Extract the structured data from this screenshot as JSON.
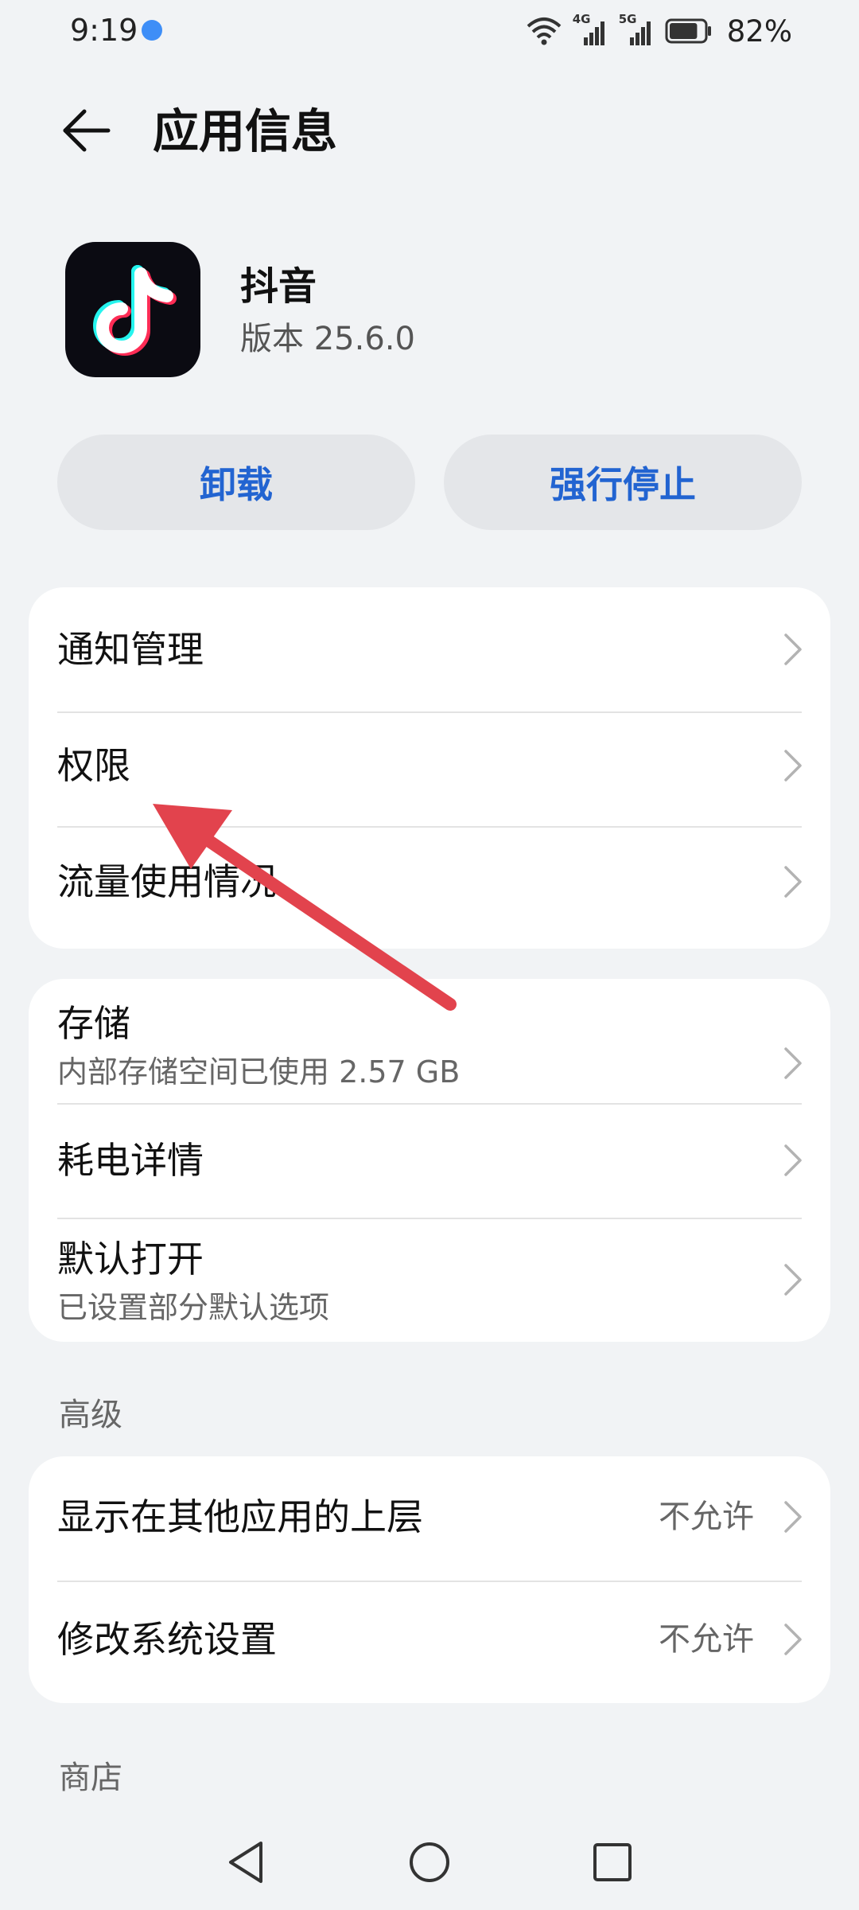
{
  "status_bar": {
    "time": "9:19",
    "network_1": "4G",
    "network_2": "5G",
    "battery_percent": "82%",
    "battery_level": 0.82
  },
  "header": {
    "title": "应用信息",
    "back_icon": "arrow-left-icon"
  },
  "app": {
    "name": "抖音",
    "version": "版本 25.6.0"
  },
  "actions": {
    "uninstall_label": "卸载",
    "force_stop_label": "强行停止"
  },
  "group1": {
    "notification_label": "通知管理",
    "permissions_label": "权限",
    "data_usage_label": "流量使用情况"
  },
  "group2": {
    "storage_label": "存储",
    "storage_sub": "内部存储空间已使用 2.57 GB",
    "battery_label": "耗电详情",
    "open_default_label": "默认打开",
    "open_default_sub": "已设置部分默认选项"
  },
  "advanced": {
    "section_label": "高级",
    "overlay_label": "显示在其他应用的上层",
    "overlay_value": "不允许",
    "modify_settings_label": "修改系统设置",
    "modify_settings_value": "不允许"
  },
  "store": {
    "section_label": "商店"
  },
  "colors": {
    "accent": "#2264d1",
    "background": "#f1f3f5",
    "card": "#ffffff",
    "annotation_arrow": "#e2434d"
  }
}
